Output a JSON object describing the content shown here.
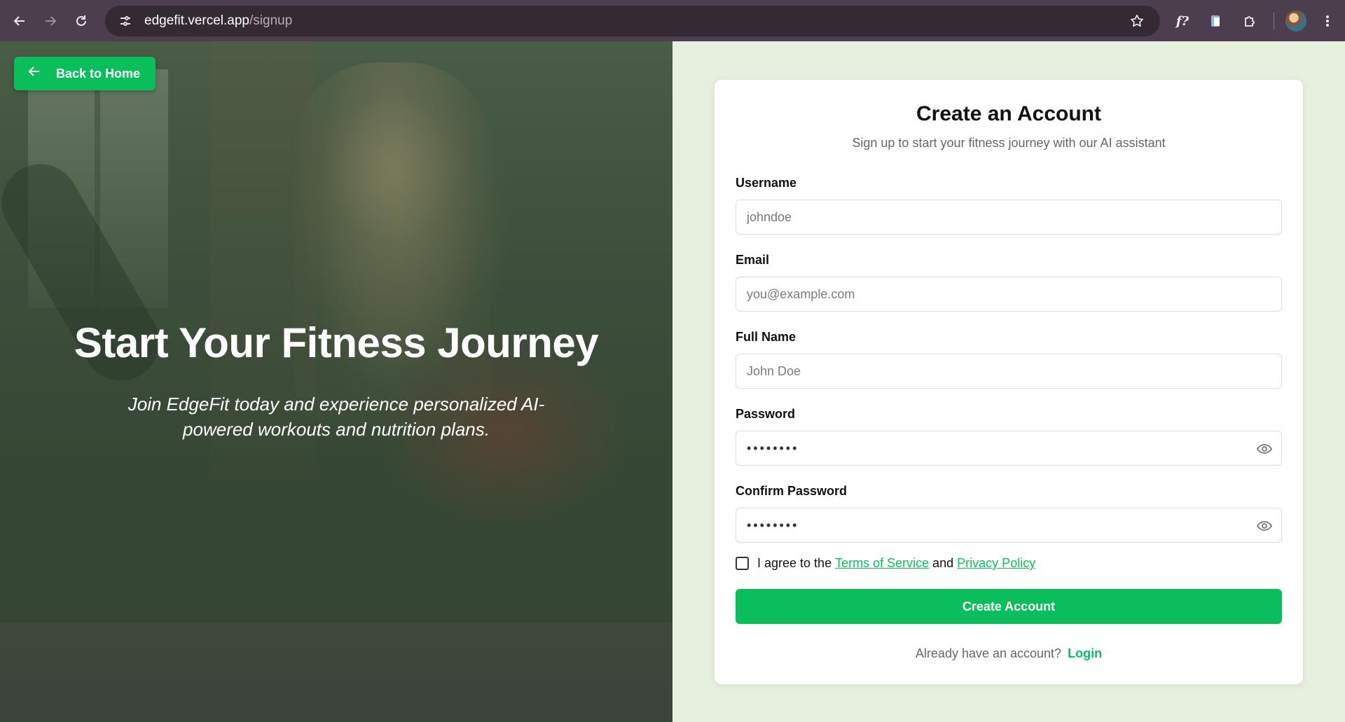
{
  "browser": {
    "url_host": "edgefit.vercel.app",
    "url_path": "/signup",
    "extension_fx_label": "f?"
  },
  "hero": {
    "back_label": "Back to Home",
    "title": "Start Your Fitness Journey",
    "subtitle": "Join EdgeFit today and experience personalized AI-powered workouts and nutrition plans."
  },
  "form": {
    "title": "Create an Account",
    "subtitle": "Sign up to start your fitness journey with our AI assistant",
    "username": {
      "label": "Username",
      "placeholder": "johndoe"
    },
    "email": {
      "label": "Email",
      "placeholder": "you@example.com"
    },
    "full_name": {
      "label": "Full Name",
      "placeholder": "John Doe"
    },
    "password": {
      "label": "Password",
      "masked_value": "••••••••"
    },
    "confirm_password": {
      "label": "Confirm Password",
      "masked_value": "••••••••"
    },
    "agree": {
      "prefix": "I agree to the",
      "terms": "Terms of Service",
      "middle": "and",
      "privacy": "Privacy Policy"
    },
    "submit_label": "Create Account",
    "login_prompt": "Already have an account?",
    "login_link": "Login"
  },
  "colors": {
    "accent": "#0abf5b",
    "page_background": "#e7f0df",
    "chrome": "#4d3e4d"
  }
}
